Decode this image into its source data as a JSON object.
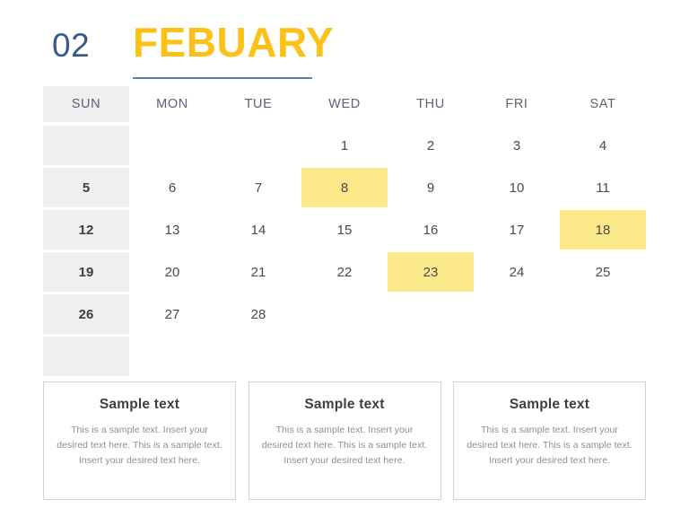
{
  "header": {
    "month_number": "02",
    "month_name": "FEBUARY",
    "accent_yellow": "#fcc118",
    "accent_blue": "#3a5a8c",
    "underline_color": "#5a7fae"
  },
  "calendar": {
    "weekdays": [
      "SUN",
      "MON",
      "TUE",
      "WED",
      "THU",
      "FRI",
      "SAT"
    ],
    "sunday_column_bg": "#efefef",
    "highlight_bg": "#fbe98a",
    "rows": [
      [
        "",
        "",
        "",
        "1",
        "2",
        "3",
        "4"
      ],
      [
        "5",
        "6",
        "7",
        "8",
        "9",
        "10",
        "11"
      ],
      [
        "12",
        "13",
        "14",
        "15",
        "16",
        "17",
        "18"
      ],
      [
        "19",
        "20",
        "21",
        "22",
        "23",
        "24",
        "25"
      ],
      [
        "26",
        "27",
        "28",
        "",
        "",
        "",
        ""
      ],
      [
        "",
        "",
        "",
        "",
        "",
        "",
        ""
      ]
    ],
    "highlighted": [
      {
        "row": 1,
        "col": 3,
        "day": "8"
      },
      {
        "row": 2,
        "col": 6,
        "day": "18"
      },
      {
        "row": 3,
        "col": 4,
        "day": "23"
      }
    ]
  },
  "boxes": [
    {
      "title": "Sample text",
      "body": "This is a sample text. Insert your desired text here. This is a sample text. Insert your desired text here."
    },
    {
      "title": "Sample text",
      "body": "This is a sample text. Insert your desired text here. This is a sample text. Insert your desired text here."
    },
    {
      "title": "Sample text",
      "body": "This is a sample text. Insert your desired text here. This is a sample text. Insert your desired text here."
    }
  ]
}
